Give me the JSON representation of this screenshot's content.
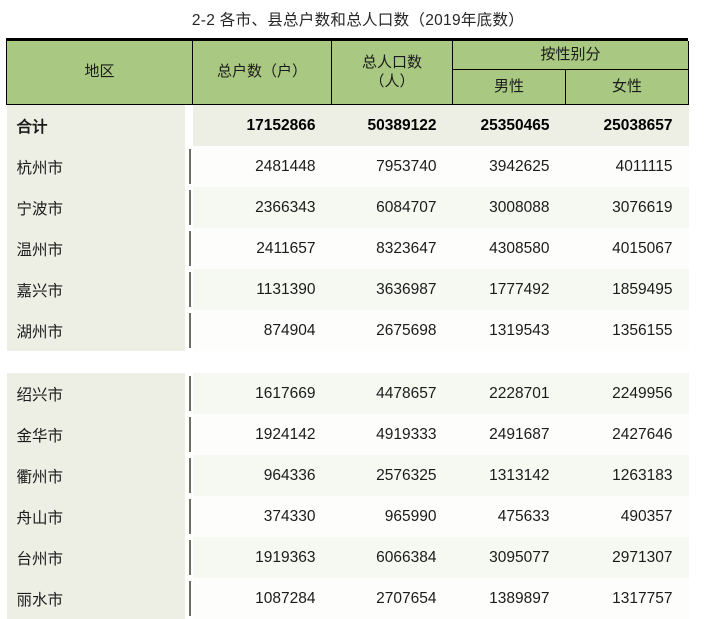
{
  "title": "2-2 各市、县总户数和总人口数（2019年底数）",
  "table": {
    "headers": {
      "region": "地区",
      "households": "总户数（户）",
      "population_line1": "总人口数",
      "population_line2": "（人）",
      "by_sex": "按性别分",
      "male": "男性",
      "female": "女性"
    },
    "columns": [
      "地区",
      "总户数（户）",
      "总人口数（人）",
      "男性",
      "女性"
    ],
    "total_row": {
      "region": "合计",
      "households": "17152866",
      "population": "50389122",
      "male": "25350465",
      "female": "25038657"
    },
    "rows": [
      {
        "region": "杭州市",
        "households": "2481448",
        "population": "7953740",
        "male": "3942625",
        "female": "4011115",
        "group": 0
      },
      {
        "region": "宁波市",
        "households": "2366343",
        "population": "6084707",
        "male": "3008088",
        "female": "3076619",
        "group": 0
      },
      {
        "region": "温州市",
        "households": "2411657",
        "population": "8323647",
        "male": "4308580",
        "female": "4015067",
        "group": 0
      },
      {
        "region": "嘉兴市",
        "households": "1131390",
        "population": "3636987",
        "male": "1777492",
        "female": "1859495",
        "group": 0
      },
      {
        "region": "湖州市",
        "households": "874904",
        "population": "2675698",
        "male": "1319543",
        "female": "1356155",
        "group": 0
      },
      {
        "region": "绍兴市",
        "households": "1617669",
        "population": "4478657",
        "male": "2228701",
        "female": "2249956",
        "group": 1
      },
      {
        "region": "金华市",
        "households": "1924142",
        "population": "4919333",
        "male": "2491687",
        "female": "2427646",
        "group": 1
      },
      {
        "region": "衢州市",
        "households": "964336",
        "population": "2576325",
        "male": "1313142",
        "female": "1263183",
        "group": 1
      },
      {
        "region": "舟山市",
        "households": "374330",
        "population": "965990",
        "male": "475633",
        "female": "490357",
        "group": 1
      },
      {
        "region": "台州市",
        "households": "1919363",
        "population": "6066384",
        "male": "3095077",
        "female": "2971307",
        "group": 1
      },
      {
        "region": "丽水市",
        "households": "1087284",
        "population": "2707654",
        "male": "1389897",
        "female": "1317757",
        "group": 1
      }
    ]
  },
  "colors": {
    "header_green": "#a9c882",
    "row_band": "#edefe5",
    "rule_grey": "#6f6f63",
    "top_border": "#000000",
    "text": "#1b1b1b"
  }
}
